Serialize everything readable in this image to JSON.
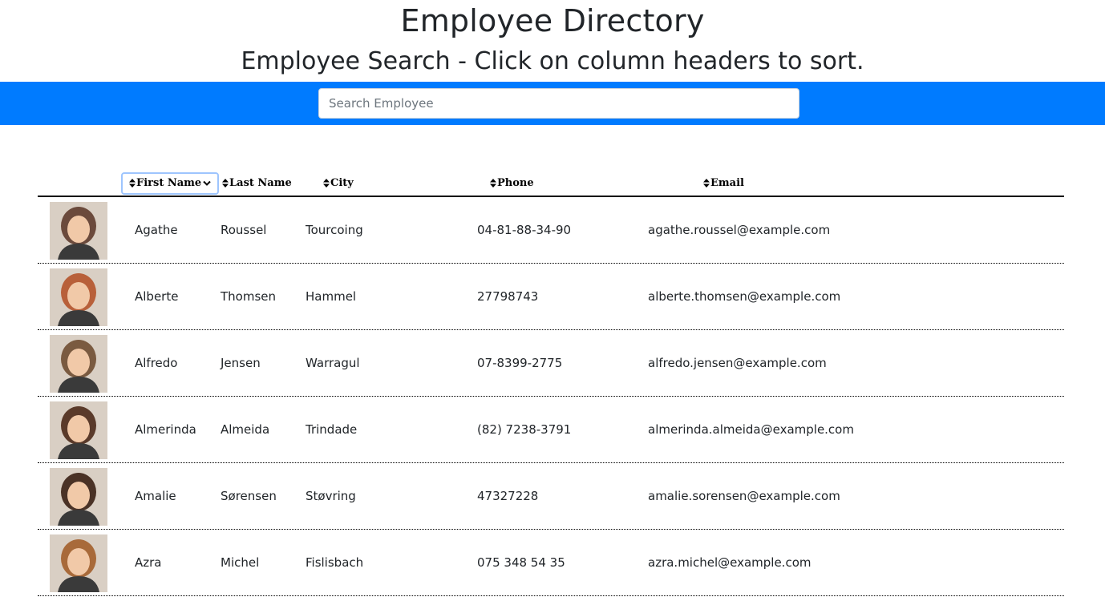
{
  "header": {
    "title": "Employee Directory",
    "subtitle": "Employee Search - Click on column headers to sort."
  },
  "search": {
    "placeholder": "Search Employee",
    "value": ""
  },
  "colors": {
    "accent": "#007bff"
  },
  "table": {
    "columns": [
      {
        "key": "first",
        "label": "First Name",
        "sorted": true
      },
      {
        "key": "last",
        "label": "Last Name",
        "sorted": false
      },
      {
        "key": "city",
        "label": "City",
        "sorted": false
      },
      {
        "key": "phone",
        "label": "Phone",
        "sorted": false
      },
      {
        "key": "email",
        "label": "Email",
        "sorted": false
      }
    ],
    "rows": [
      {
        "first": "Agathe",
        "last": "Roussel",
        "city": "Tourcoing",
        "phone": "04-81-88-34-90",
        "email": "agathe.roussel@example.com",
        "avatar": "#6b4a3c"
      },
      {
        "first": "Alberte",
        "last": "Thomsen",
        "city": "Hammel",
        "phone": "27798743",
        "email": "alberte.thomsen@example.com",
        "avatar": "#b8603a"
      },
      {
        "first": "Alfredo",
        "last": "Jensen",
        "city": "Warragul",
        "phone": "07-8399-2775",
        "email": "alfredo.jensen@example.com",
        "avatar": "#7a5a40"
      },
      {
        "first": "Almerinda",
        "last": "Almeida",
        "city": "Trindade",
        "phone": "(82) 7238-3791",
        "email": "almerinda.almeida@example.com",
        "avatar": "#5a3a2a"
      },
      {
        "first": "Amalie",
        "last": "Sørensen",
        "city": "Støvring",
        "phone": "47327228",
        "email": "amalie.sorensen@example.com",
        "avatar": "#4a3226"
      },
      {
        "first": "Azra",
        "last": "Michel",
        "city": "Fislisbach",
        "phone": "075 348 54 35",
        "email": "azra.michel@example.com",
        "avatar": "#a86a3a"
      }
    ]
  }
}
